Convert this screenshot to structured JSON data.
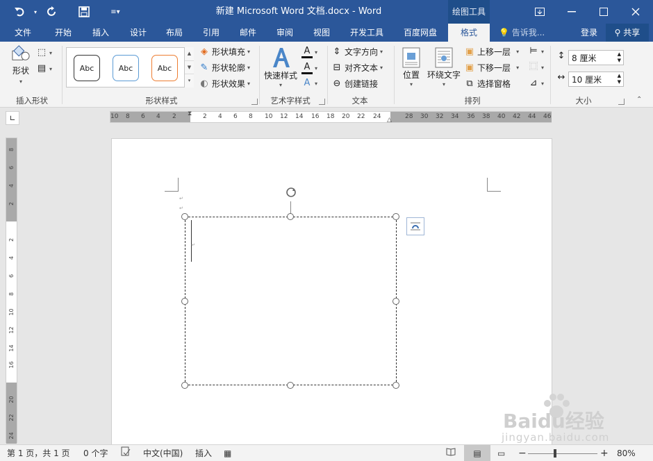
{
  "app": {
    "title": "新建 Microsoft Word 文档.docx - Word",
    "context_tool": "绘图工具",
    "qat": [
      "undo-icon",
      "redo-icon",
      "save-icon",
      "customize-icon"
    ],
    "window_buttons": [
      "ribbon-display-icon",
      "minimize-icon",
      "restore-icon",
      "close-icon"
    ]
  },
  "tabs": [
    {
      "label": "文件"
    },
    {
      "label": "开始"
    },
    {
      "label": "插入"
    },
    {
      "label": "设计"
    },
    {
      "label": "布局"
    },
    {
      "label": "引用"
    },
    {
      "label": "邮件"
    },
    {
      "label": "审阅"
    },
    {
      "label": "视图"
    },
    {
      "label": "开发工具"
    },
    {
      "label": "百度网盘"
    },
    {
      "label": "格式",
      "active": true
    }
  ],
  "tell_me": "告诉我...",
  "login": "登录",
  "share": "共享",
  "ribbon": {
    "insert_shapes": {
      "label": "插入形状",
      "shapes": "形状"
    },
    "shape_styles": {
      "label": "形状样式",
      "swatches": [
        {
          "text": "Abc",
          "border": "#333333"
        },
        {
          "text": "Abc",
          "border": "#5b9bd5"
        },
        {
          "text": "Abc",
          "border": "#ed7d31"
        }
      ],
      "fill": "形状填充",
      "outline": "形状轮廓",
      "effect": "形状效果"
    },
    "wordart": {
      "label": "艺术字样式",
      "quick": "快速样式"
    },
    "text": {
      "label": "文本",
      "direction": "文字方向",
      "align": "对齐文本",
      "link": "创建链接"
    },
    "arrange": {
      "label": "排列",
      "position": "位置",
      "wrap": "环绕文字",
      "forward": "上移一层",
      "backward": "下移一层",
      "pane": "选择窗格"
    },
    "size": {
      "label": "大小",
      "height": "8 厘米",
      "width": "10 厘米"
    }
  },
  "ruler": {
    "h_ticks": [
      "10",
      "8",
      "6",
      "4",
      "2",
      "2",
      "4",
      "6",
      "8",
      "10",
      "12",
      "14",
      "16",
      "18",
      "20",
      "22",
      "24",
      "28",
      "30",
      "32",
      "34",
      "36",
      "38",
      "40",
      "42",
      "44",
      "46"
    ],
    "v_ticks": [
      "8",
      "6",
      "4",
      "2",
      "2",
      "4",
      "6",
      "8",
      "10",
      "12",
      "14",
      "16",
      "20",
      "22",
      "24"
    ]
  },
  "status": {
    "page": "第 1 页，共 1 页",
    "words": "0 个字",
    "language": "中文(中国)",
    "mode": "插入",
    "zoom_level": "80%",
    "zoom_minus": "−",
    "zoom_plus": "+"
  },
  "watermark": {
    "brand": "Baidu经验",
    "url": "jingyan.baidu.com"
  },
  "colors": {
    "titlebar": "#2b579a",
    "context_tab": "#1f4e8a",
    "ribbon": "#f3f3f3"
  }
}
